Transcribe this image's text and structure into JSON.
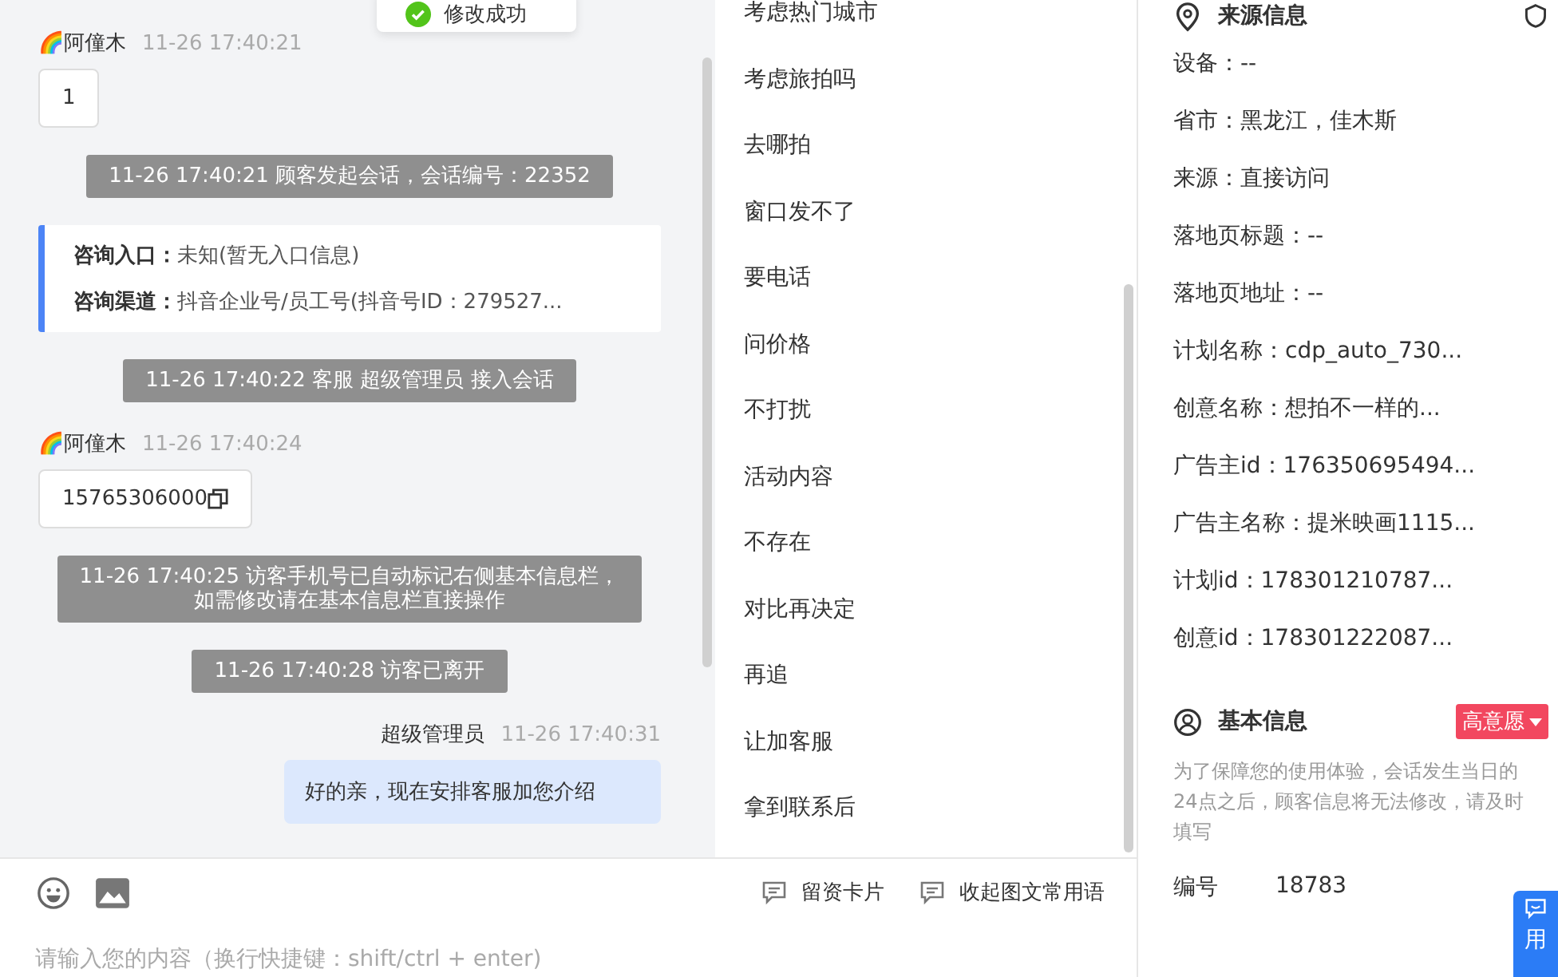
{
  "toast": {
    "text": "修改成功"
  },
  "chat": {
    "messages": [
      {
        "kind": "visitor",
        "sender": "🌈阿僮木",
        "time": "11-26 17:40:21",
        "text": "1",
        "copyable": false
      },
      {
        "kind": "system",
        "lines": [
          "11-26 17:40:21 顾客发起会话，会话编号：22352"
        ]
      },
      {
        "kind": "entry",
        "rows": [
          {
            "label": "咨询入口：",
            "value": "未知(暂无入口信息)"
          },
          {
            "label": "咨询渠道：",
            "value": "抖音企业号/员工号(抖音号ID：279527..."
          }
        ]
      },
      {
        "kind": "system",
        "lines": [
          "11-26 17:40:22 客服 超级管理员 接入会话"
        ]
      },
      {
        "kind": "visitor",
        "sender": "🌈阿僮木",
        "time": "11-26 17:40:24",
        "text": "15765306000",
        "copyable": true
      },
      {
        "kind": "system",
        "lines": [
          "11-26 17:40:25 访客手机号已自动标记右侧基本信息栏，",
          "如需修改请在基本信息栏直接操作"
        ]
      },
      {
        "kind": "system",
        "lines": [
          "11-26 17:40:28 访客已离开"
        ]
      },
      {
        "kind": "agent",
        "sender": "超级管理员",
        "time": "11-26 17:40:31",
        "text": "好的亲，现在安排客服加您介绍"
      }
    ]
  },
  "quick_replies": [
    "考虑热门城市",
    "考虑旅拍吗",
    "去哪拍",
    "窗口发不了",
    "要电话",
    "问价格",
    "不打扰",
    "活动内容",
    "不存在",
    "对比再决定",
    "再追",
    "让加客服",
    "拿到联系后"
  ],
  "composer": {
    "placeholder": "请输入您的内容（换行快捷键：shift/ctrl + enter)",
    "actions": [
      "留资卡片",
      "收起图文常用语"
    ]
  },
  "source_info": {
    "title": "来源信息",
    "rows": [
      "设备：--",
      "省市：黑龙江，佳木斯",
      "来源：直接访问",
      "落地页标题：--",
      "落地页地址：--",
      "计划名称：cdp_auto_730...",
      "创意名称：想拍不一样的...",
      "广告主id：176350695494...",
      "广告主名称：提米映画1115...",
      "计划id：178301210787...",
      "创意id：178301222087..."
    ]
  },
  "basic_info": {
    "title": "基本信息",
    "intent_tag": "高意愿",
    "note": "为了保障您的使用体验，会话发生当日的24点之后，顾客信息将无法修改，请及时填写",
    "fields": [
      {
        "label": "编号",
        "value": "18783"
      }
    ]
  },
  "float_button": {
    "label": "用"
  }
}
